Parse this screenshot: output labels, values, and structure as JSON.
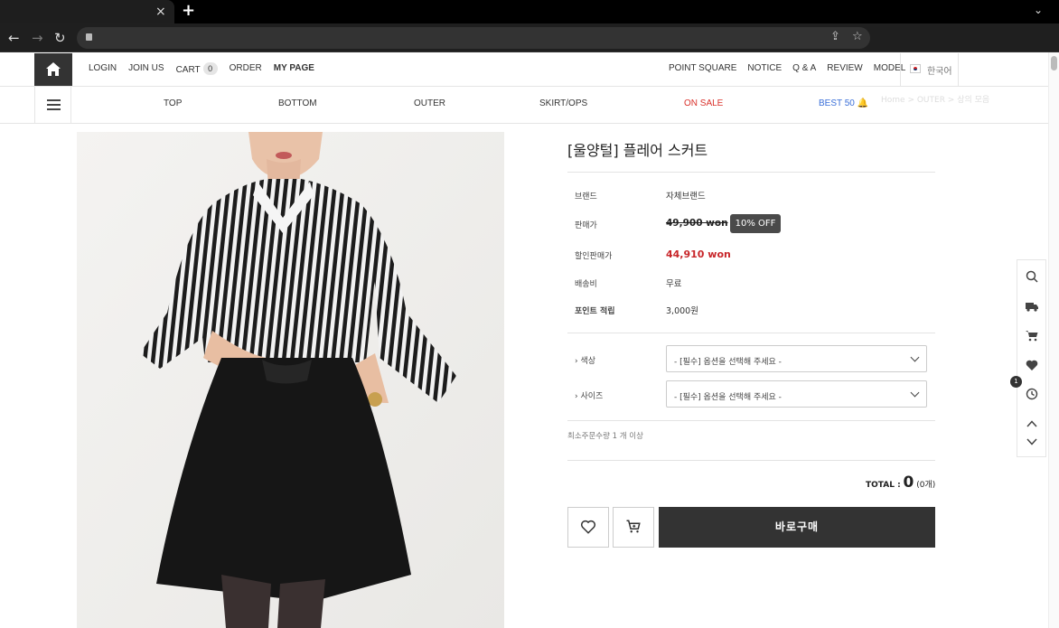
{
  "browser": {
    "tab_close": "×",
    "new_tab": "+",
    "tab_menu": "⌄"
  },
  "header": {
    "top_links": [
      "LOGIN",
      "JOIN US",
      "CART",
      "ORDER",
      "MY PAGE"
    ],
    "cart_count": "0",
    "right_links": [
      "POINT SQUARE",
      "NOTICE",
      "Q & A",
      "REVIEW",
      "MODEL"
    ],
    "language": "한국어"
  },
  "categories": {
    "items": [
      "TOP",
      "BOTTOM",
      "OUTER",
      "SKIRT/OPS",
      "ON SALE",
      "BEST 50 🔔"
    ],
    "sale_color": "#d9312b",
    "best_color": "#3a6fd8"
  },
  "breadcrumb_ghost": "Home > OUTER > 상의 모음",
  "product": {
    "title": "[울양털] 플레어 스커트",
    "rows": [
      {
        "label": "브랜드",
        "value": "자체브랜드"
      },
      {
        "label": "판매가",
        "value": "49,900 won"
      },
      {
        "label": "할인판매가",
        "value": "44,910 won"
      },
      {
        "label": "배송비",
        "value": "무료"
      },
      {
        "label": "포인트 적립",
        "value": "3,000원"
      }
    ],
    "discount_badge": "10% OFF",
    "options": [
      {
        "label": "› 색상",
        "value": "- [필수] 옵션을 선택해 주세요 -"
      },
      {
        "label": "› 사이즈",
        "value": "- [필수] 옵션을 선택해 주세요 -"
      }
    ],
    "min_qty": "최소주문수량 1 개 이상",
    "total_label": "TOTAL :",
    "total_value": "0",
    "total_count": "(0개)",
    "buy_label": "바로구매",
    "sale_price_color": "#c8262a"
  },
  "quickbar": {
    "icons": [
      "search-icon",
      "truck-icon",
      "cart-icon",
      "heart-icon",
      "clock-icon",
      "up-icon",
      "down-icon"
    ],
    "recent_badge": "1"
  }
}
